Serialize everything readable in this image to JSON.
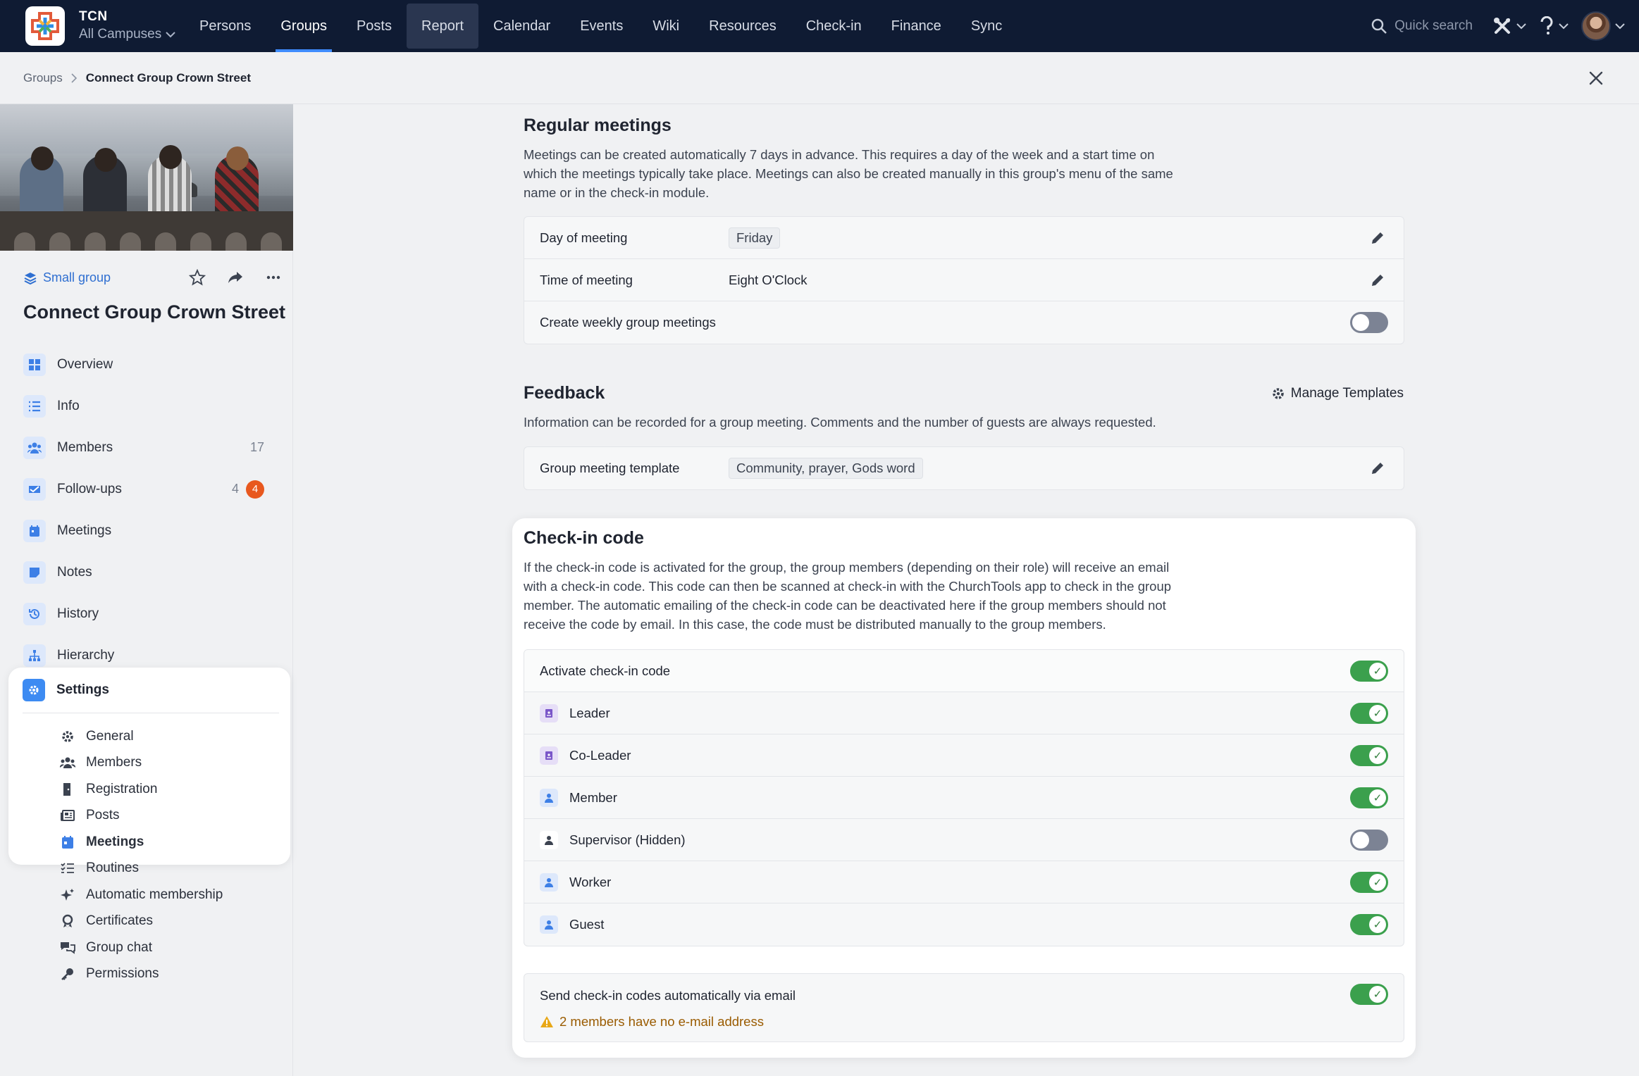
{
  "topnav": {
    "org": "TCN",
    "campus": "All Campuses",
    "items": [
      {
        "label": "Persons"
      },
      {
        "label": "Groups"
      },
      {
        "label": "Posts"
      },
      {
        "label": "Report"
      },
      {
        "label": "Calendar"
      },
      {
        "label": "Events"
      },
      {
        "label": "Wiki"
      },
      {
        "label": "Resources"
      },
      {
        "label": "Check-in"
      },
      {
        "label": "Finance"
      },
      {
        "label": "Sync"
      }
    ],
    "active_item": "Groups",
    "hovered_item": "Report",
    "search_placeholder": "Quick search",
    "accent": "#3f8cff",
    "bg": "#0f1b33"
  },
  "breadcrumb": {
    "parent": "Groups",
    "current": "Connect Group Crown Street"
  },
  "sidebar": {
    "group_type": "Small group",
    "group_title": "Connect Group Crown Street",
    "menu": [
      {
        "label": "Overview",
        "icon": "grid-icon"
      },
      {
        "label": "Info",
        "icon": "list-icon"
      },
      {
        "label": "Members",
        "icon": "users-icon",
        "count": "17"
      },
      {
        "label": "Follow-ups",
        "icon": "followup-icon",
        "count": "4",
        "badge": "4"
      },
      {
        "label": "Meetings",
        "icon": "calendar-icon"
      },
      {
        "label": "Notes",
        "icon": "note-icon"
      },
      {
        "label": "History",
        "icon": "history-icon"
      },
      {
        "label": "Hierarchy",
        "icon": "hierarchy-icon"
      }
    ],
    "settings": {
      "label": "Settings",
      "items": [
        {
          "label": "General",
          "icon": "gear-icon"
        },
        {
          "label": "Members",
          "icon": "users-icon"
        },
        {
          "label": "Registration",
          "icon": "door-icon"
        },
        {
          "label": "Posts",
          "icon": "newspaper-icon"
        },
        {
          "label": "Meetings",
          "icon": "calendar-icon",
          "active": true
        },
        {
          "label": "Routines",
          "icon": "checklist-icon"
        },
        {
          "label": "Automatic membership",
          "icon": "sparkles-icon"
        },
        {
          "label": "Certificates",
          "icon": "certificate-icon"
        },
        {
          "label": "Group chat",
          "icon": "chat-icon"
        },
        {
          "label": "Permissions",
          "icon": "key-icon"
        }
      ]
    },
    "badge_color": "#e8581e"
  },
  "regular_meetings": {
    "title": "Regular meetings",
    "description": "Meetings can be created automatically 7 days in advance. This requires a day of the week and a start time on which the meetings typically take place. Meetings can also be created manually in this group's menu of the same name or in the check-in module.",
    "rows": {
      "day_label": "Day of meeting",
      "day_value": "Friday",
      "time_label": "Time of meeting",
      "time_value": "Eight O'Clock",
      "weekly_label": "Create weekly group meetings",
      "weekly_on": false
    }
  },
  "feedback": {
    "title": "Feedback",
    "manage_label": "Manage Templates",
    "description": "Information can be recorded for a group meeting. Comments and the number of guests are always requested.",
    "template_label": "Group meeting template",
    "template_value": "Community, prayer, Gods word"
  },
  "checkin": {
    "title": "Check-in code",
    "description": "If the check-in code is activated for the group, the group members (depending on their role) will receive an email with a check-in code. This code can then be scanned at check-in with the ChurchTools app to check in the group member. The automatic emailing of the check-in code can be deactivated here if the group members should not receive the code by email. In this case, the code must be distributed manually to the group members.",
    "activate_label": "Activate check-in code",
    "activate_on": true,
    "roles": [
      {
        "label": "Leader",
        "on": true,
        "icon": "leader-badge-icon"
      },
      {
        "label": "Co-Leader",
        "on": true,
        "icon": "leader-badge-icon"
      },
      {
        "label": "Member",
        "on": true,
        "icon": "person-icon"
      },
      {
        "label": "Supervisor (Hidden)",
        "on": false,
        "icon": "person-icon"
      },
      {
        "label": "Worker",
        "on": true,
        "icon": "person-icon"
      },
      {
        "label": "Guest",
        "on": true,
        "icon": "person-icon"
      }
    ],
    "email_label": "Send check-in codes automatically via email",
    "email_on": true,
    "warning": "2 members have no e-mail address",
    "toggle_on_color": "#3ba04d",
    "toggle_off_color": "#7c8394"
  }
}
